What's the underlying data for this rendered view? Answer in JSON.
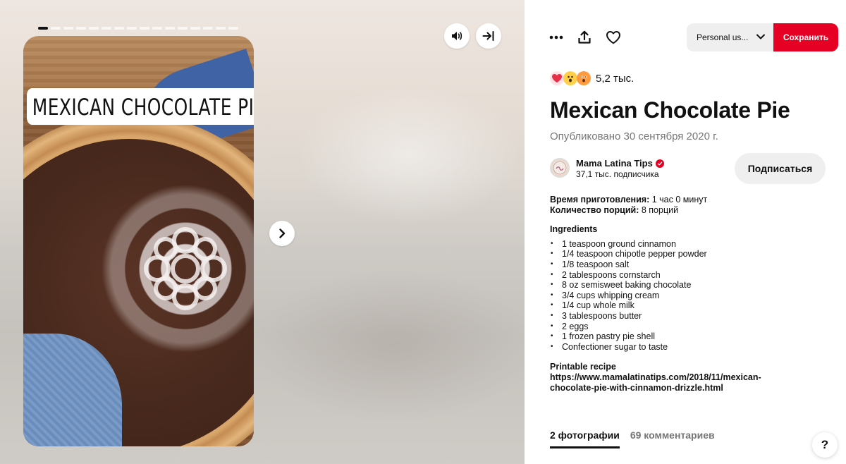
{
  "story": {
    "overlay_title": "MEXICAN CHOCOLATE PIE",
    "slide_count": 16,
    "active_slide": 1
  },
  "controls": {
    "sound_icon": "speaker-icon",
    "expand_icon": "arrow-to-right-icon",
    "next_icon": "chevron-right-icon"
  },
  "toolbar": {
    "more_icon": "ellipsis-icon",
    "share_icon": "share-upload-icon",
    "like_icon": "heart-icon",
    "board_select": "Personal us...",
    "save_label": "Сохранить",
    "save_color": "#e60023"
  },
  "pin": {
    "reaction_count": "5,2 тыс.",
    "title": "Mexican Chocolate Pie",
    "published": "Опубликовано 30 сентября 2020 г."
  },
  "creator": {
    "name": "Mama Latina Tips",
    "followers": "37,1 тыс. подписчика",
    "follow_label": "Подписаться"
  },
  "description": {
    "prep_label": "Время приготовления:",
    "prep_value": " 1 час 0 минут",
    "servings_label": "Количество порций:",
    "servings_value": " 8 порций",
    "ingredients_title": "Ingredients",
    "ingredients": [
      "1 teaspoon ground cinnamon",
      "1/4 teaspoon chipotle pepper powder",
      "1/8 teaspoon salt",
      "2 tablespoons cornstarch",
      "8 oz semisweet baking chocolate",
      "3/4 cups whipping cream",
      "1/4 cup whole milk",
      "3 tablespoons butter",
      "2 eggs",
      "1 frozen pastry pie shell",
      "Confectioner sugar to taste"
    ],
    "printable_title": "Printable recipe",
    "printable_url": "https://www.mamalatinatips.com/2018/11/mexican-chocolate-pie-with-cinnamon-drizzle.html"
  },
  "tabs": [
    {
      "label": "2 фотографии",
      "active": true
    },
    {
      "label": "69 комментариев",
      "active": false
    }
  ],
  "help": {
    "label": "?"
  }
}
